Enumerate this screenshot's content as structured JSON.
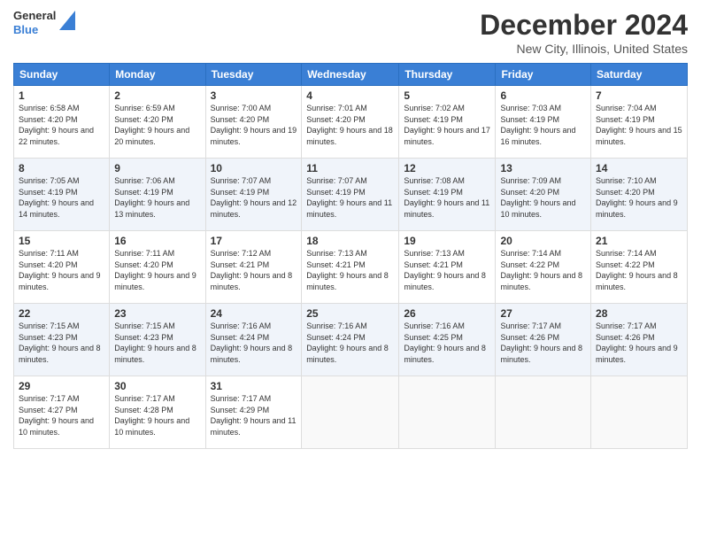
{
  "header": {
    "logo": {
      "general": "General",
      "blue": "Blue"
    },
    "title": "December 2024",
    "location": "New City, Illinois, United States"
  },
  "days_of_week": [
    "Sunday",
    "Monday",
    "Tuesday",
    "Wednesday",
    "Thursday",
    "Friday",
    "Saturday"
  ],
  "weeks": [
    [
      {
        "day": 1,
        "sunrise": "6:58 AM",
        "sunset": "4:20 PM",
        "daylight": "9 hours and 22 minutes."
      },
      {
        "day": 2,
        "sunrise": "6:59 AM",
        "sunset": "4:20 PM",
        "daylight": "9 hours and 20 minutes."
      },
      {
        "day": 3,
        "sunrise": "7:00 AM",
        "sunset": "4:20 PM",
        "daylight": "9 hours and 19 minutes."
      },
      {
        "day": 4,
        "sunrise": "7:01 AM",
        "sunset": "4:20 PM",
        "daylight": "9 hours and 18 minutes."
      },
      {
        "day": 5,
        "sunrise": "7:02 AM",
        "sunset": "4:19 PM",
        "daylight": "9 hours and 17 minutes."
      },
      {
        "day": 6,
        "sunrise": "7:03 AM",
        "sunset": "4:19 PM",
        "daylight": "9 hours and 16 minutes."
      },
      {
        "day": 7,
        "sunrise": "7:04 AM",
        "sunset": "4:19 PM",
        "daylight": "9 hours and 15 minutes."
      }
    ],
    [
      {
        "day": 8,
        "sunrise": "7:05 AM",
        "sunset": "4:19 PM",
        "daylight": "9 hours and 14 minutes."
      },
      {
        "day": 9,
        "sunrise": "7:06 AM",
        "sunset": "4:19 PM",
        "daylight": "9 hours and 13 minutes."
      },
      {
        "day": 10,
        "sunrise": "7:07 AM",
        "sunset": "4:19 PM",
        "daylight": "9 hours and 12 minutes."
      },
      {
        "day": 11,
        "sunrise": "7:07 AM",
        "sunset": "4:19 PM",
        "daylight": "9 hours and 11 minutes."
      },
      {
        "day": 12,
        "sunrise": "7:08 AM",
        "sunset": "4:19 PM",
        "daylight": "9 hours and 11 minutes."
      },
      {
        "day": 13,
        "sunrise": "7:09 AM",
        "sunset": "4:20 PM",
        "daylight": "9 hours and 10 minutes."
      },
      {
        "day": 14,
        "sunrise": "7:10 AM",
        "sunset": "4:20 PM",
        "daylight": "9 hours and 9 minutes."
      }
    ],
    [
      {
        "day": 15,
        "sunrise": "7:11 AM",
        "sunset": "4:20 PM",
        "daylight": "9 hours and 9 minutes."
      },
      {
        "day": 16,
        "sunrise": "7:11 AM",
        "sunset": "4:20 PM",
        "daylight": "9 hours and 9 minutes."
      },
      {
        "day": 17,
        "sunrise": "7:12 AM",
        "sunset": "4:21 PM",
        "daylight": "9 hours and 8 minutes."
      },
      {
        "day": 18,
        "sunrise": "7:13 AM",
        "sunset": "4:21 PM",
        "daylight": "9 hours and 8 minutes."
      },
      {
        "day": 19,
        "sunrise": "7:13 AM",
        "sunset": "4:21 PM",
        "daylight": "9 hours and 8 minutes."
      },
      {
        "day": 20,
        "sunrise": "7:14 AM",
        "sunset": "4:22 PM",
        "daylight": "9 hours and 8 minutes."
      },
      {
        "day": 21,
        "sunrise": "7:14 AM",
        "sunset": "4:22 PM",
        "daylight": "9 hours and 8 minutes."
      }
    ],
    [
      {
        "day": 22,
        "sunrise": "7:15 AM",
        "sunset": "4:23 PM",
        "daylight": "9 hours and 8 minutes."
      },
      {
        "day": 23,
        "sunrise": "7:15 AM",
        "sunset": "4:23 PM",
        "daylight": "9 hours and 8 minutes."
      },
      {
        "day": 24,
        "sunrise": "7:16 AM",
        "sunset": "4:24 PM",
        "daylight": "9 hours and 8 minutes."
      },
      {
        "day": 25,
        "sunrise": "7:16 AM",
        "sunset": "4:24 PM",
        "daylight": "9 hours and 8 minutes."
      },
      {
        "day": 26,
        "sunrise": "7:16 AM",
        "sunset": "4:25 PM",
        "daylight": "9 hours and 8 minutes."
      },
      {
        "day": 27,
        "sunrise": "7:17 AM",
        "sunset": "4:26 PM",
        "daylight": "9 hours and 8 minutes."
      },
      {
        "day": 28,
        "sunrise": "7:17 AM",
        "sunset": "4:26 PM",
        "daylight": "9 hours and 9 minutes."
      }
    ],
    [
      {
        "day": 29,
        "sunrise": "7:17 AM",
        "sunset": "4:27 PM",
        "daylight": "9 hours and 10 minutes."
      },
      {
        "day": 30,
        "sunrise": "7:17 AM",
        "sunset": "4:28 PM",
        "daylight": "9 hours and 10 minutes."
      },
      {
        "day": 31,
        "sunrise": "7:17 AM",
        "sunset": "4:29 PM",
        "daylight": "9 hours and 11 minutes."
      },
      null,
      null,
      null,
      null
    ]
  ]
}
